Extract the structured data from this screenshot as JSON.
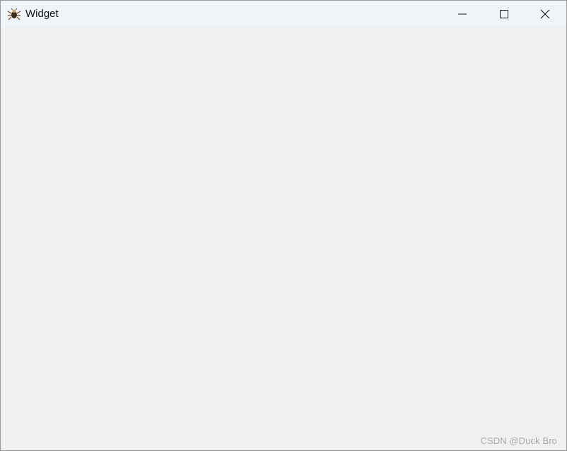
{
  "window": {
    "title": "Widget",
    "app_icon": "bug-icon",
    "controls": {
      "minimize_icon": "minimize-icon",
      "maximize_icon": "maximize-icon",
      "close_icon": "close-icon"
    }
  },
  "watermark": {
    "text": "CSDN @Duck Bro"
  },
  "colors": {
    "titlebar": "#eff4f9",
    "client_background": "#f0f0f0",
    "watermark_text": "#a9a9a9"
  }
}
